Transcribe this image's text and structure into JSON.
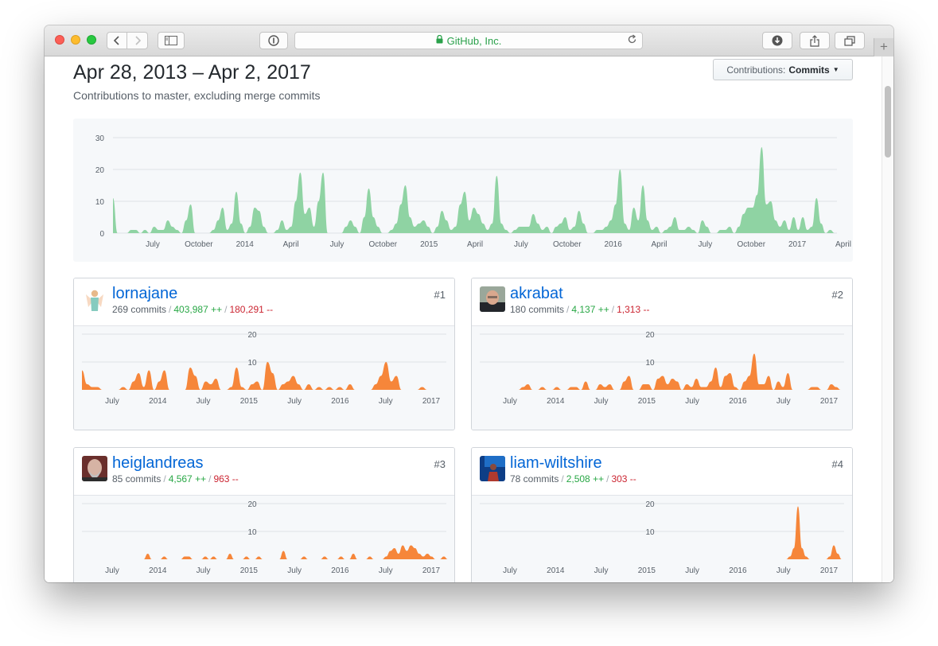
{
  "browser": {
    "url_display": "GitHub, Inc.",
    "icons": {
      "back": "chevron-left-icon",
      "forward": "chevron-right-icon",
      "sidebar": "sidebar-icon",
      "info": "info-icon",
      "lock": "lock-icon",
      "reload": "reload-icon",
      "download": "download-icon",
      "share": "share-icon",
      "tabs": "tabs-icon",
      "new_tab": "plus-icon"
    }
  },
  "page": {
    "date_range": "Apr 28, 2013 – Apr 2, 2017",
    "subtitle": "Contributions to master, excluding merge commits",
    "contrib_select": {
      "prefix": "Contributions:",
      "value": "Commits"
    }
  },
  "colors": {
    "main_area": "#8fd3a3",
    "user_area": "#f6863a",
    "link": "#0366d6",
    "additions": "#28a745",
    "deletions": "#cb2431"
  },
  "chart_data": [
    {
      "type": "area",
      "ylim": [
        0,
        30
      ],
      "yticks": [
        "0",
        "10",
        "20",
        "30"
      ],
      "xticks": [
        "July",
        "October",
        "2014",
        "April",
        "July",
        "October",
        "2015",
        "April",
        "July",
        "October",
        "2016",
        "April",
        "July",
        "October",
        "2017",
        "April"
      ],
      "grid": true,
      "values": [
        11,
        0,
        0,
        0,
        1,
        1,
        0,
        1,
        0,
        2,
        1,
        1,
        4,
        2,
        1,
        0,
        4,
        9,
        0,
        0,
        0,
        0,
        1,
        4,
        8,
        1,
        3,
        13,
        3,
        0,
        2,
        8,
        7,
        2,
        0,
        0,
        1,
        4,
        1,
        2,
        10,
        19,
        6,
        8,
        2,
        10,
        19,
        0,
        0,
        0,
        0,
        2,
        4,
        2,
        0,
        5,
        14,
        5,
        2,
        0,
        0,
        1,
        3,
        9,
        15,
        5,
        2,
        3,
        4,
        2,
        0,
        2,
        7,
        4,
        1,
        2,
        9,
        13,
        4,
        8,
        6,
        3,
        1,
        3,
        18,
        3,
        1,
        0,
        1,
        2,
        2,
        2,
        6,
        3,
        1,
        2,
        0,
        2,
        3,
        5,
        1,
        2,
        7,
        3,
        0,
        0,
        1,
        1,
        2,
        4,
        9,
        20,
        3,
        1,
        8,
        4,
        15,
        4,
        1,
        2,
        0,
        1,
        2,
        5,
        1,
        1,
        2,
        1,
        0,
        4,
        2,
        0,
        0,
        1,
        1,
        2,
        0,
        2,
        6,
        8,
        8,
        12,
        27,
        9,
        10,
        4,
        2,
        4,
        1,
        5,
        1,
        5,
        1,
        2,
        11,
        3,
        0,
        1,
        0,
        0
      ]
    },
    {
      "type": "area",
      "ylim": [
        0,
        20
      ],
      "yticks": [
        "10",
        "20"
      ],
      "xticks": [
        "July",
        "2014",
        "July",
        "2015",
        "July",
        "2016",
        "July",
        "2017"
      ],
      "values": [
        7,
        2,
        1,
        1,
        0,
        0,
        0,
        0,
        1,
        0,
        3,
        6,
        1,
        7,
        0,
        3,
        7,
        0,
        0,
        0,
        0,
        8,
        5,
        0,
        3,
        2,
        4,
        0,
        0,
        1,
        8,
        1,
        0,
        2,
        3,
        0,
        10,
        6,
        0,
        2,
        3,
        5,
        2,
        0,
        2,
        0,
        1,
        0,
        1,
        0,
        1,
        0,
        2,
        0,
        0,
        0,
        0,
        2,
        5,
        10,
        3,
        5,
        0,
        0,
        0,
        0,
        1,
        0,
        0,
        0,
        0,
        0
      ]
    },
    {
      "type": "area",
      "ylim": [
        0,
        20
      ],
      "yticks": [
        "10",
        "20"
      ],
      "xticks": [
        "July",
        "2014",
        "July",
        "2015",
        "July",
        "2016",
        "July",
        "2017"
      ],
      "values": [
        0,
        0,
        0,
        0,
        0,
        0,
        0,
        0,
        0,
        1,
        2,
        0,
        0,
        1,
        0,
        0,
        1,
        0,
        0,
        1,
        1,
        0,
        3,
        0,
        0,
        2,
        1,
        2,
        0,
        0,
        3,
        5,
        0,
        0,
        2,
        2,
        0,
        4,
        5,
        2,
        4,
        3,
        0,
        2,
        1,
        4,
        1,
        1,
        3,
        8,
        1,
        5,
        6,
        1,
        0,
        3,
        5,
        13,
        2,
        2,
        5,
        0,
        3,
        1,
        6,
        0,
        0,
        0,
        0,
        1,
        1,
        0,
        0,
        2,
        1,
        0,
        0
      ]
    },
    {
      "type": "area",
      "ylim": [
        0,
        20
      ],
      "yticks": [
        "10",
        "20"
      ],
      "xticks": [
        "July",
        "2014",
        "July",
        "2015",
        "July",
        "2016",
        "July",
        "2017"
      ],
      "values": [
        0,
        0,
        0,
        0,
        0,
        0,
        0,
        0,
        0,
        0,
        0,
        0,
        0,
        0,
        0,
        0,
        2,
        0,
        0,
        0,
        1,
        0,
        0,
        0,
        0,
        1,
        1,
        0,
        0,
        0,
        1,
        0,
        1,
        0,
        0,
        0,
        2,
        0,
        0,
        0,
        1,
        0,
        0,
        1,
        0,
        0,
        0,
        0,
        0,
        3,
        0,
        0,
        0,
        0,
        1,
        0,
        0,
        0,
        0,
        1,
        0,
        0,
        0,
        1,
        0,
        0,
        2,
        0,
        0,
        0,
        1,
        0,
        0,
        0,
        1,
        3,
        4,
        2,
        5,
        3,
        5,
        4,
        2,
        1,
        2,
        1,
        0,
        0,
        1,
        0
      ]
    },
    {
      "type": "area",
      "ylim": [
        0,
        20
      ],
      "yticks": [
        "10",
        "20"
      ],
      "xticks": [
        "July",
        "2014",
        "July",
        "2015",
        "July",
        "2016",
        "July",
        "2017"
      ],
      "values": [
        0,
        0,
        0,
        0,
        0,
        0,
        0,
        0,
        0,
        0,
        0,
        0,
        0,
        0,
        0,
        0,
        0,
        0,
        0,
        0,
        0,
        0,
        0,
        0,
        0,
        0,
        0,
        0,
        0,
        0,
        0,
        0,
        0,
        0,
        0,
        0,
        0,
        0,
        0,
        0,
        0,
        0,
        0,
        0,
        0,
        0,
        0,
        0,
        0,
        0,
        0,
        0,
        0,
        0,
        0,
        0,
        0,
        0,
        0,
        0,
        0,
        0,
        0,
        0,
        0,
        0,
        0,
        0,
        0,
        0,
        0,
        0,
        0,
        0,
        0,
        0,
        0,
        0,
        1,
        4,
        19,
        4,
        1,
        0,
        0,
        0,
        0,
        0,
        1,
        5,
        2,
        0,
        0
      ]
    }
  ],
  "contributors": [
    {
      "login": "lornajane",
      "commits": "269 commits",
      "additions": "403,987 ++",
      "deletions": "180,291 --",
      "rank": "#1",
      "avatar": "avatar-lornajane"
    },
    {
      "login": "akrabat",
      "commits": "180 commits",
      "additions": "4,137 ++",
      "deletions": "1,313 --",
      "rank": "#2",
      "avatar": "avatar-akrabat"
    },
    {
      "login": "heiglandreas",
      "commits": "85 commits",
      "additions": "4,567 ++",
      "deletions": "963 --",
      "rank": "#3",
      "avatar": "avatar-heiglandreas"
    },
    {
      "login": "liam-wiltshire",
      "commits": "78 commits",
      "additions": "2,508 ++",
      "deletions": "303 --",
      "rank": "#4",
      "avatar": "avatar-liam-wiltshire"
    }
  ],
  "separator": "/"
}
